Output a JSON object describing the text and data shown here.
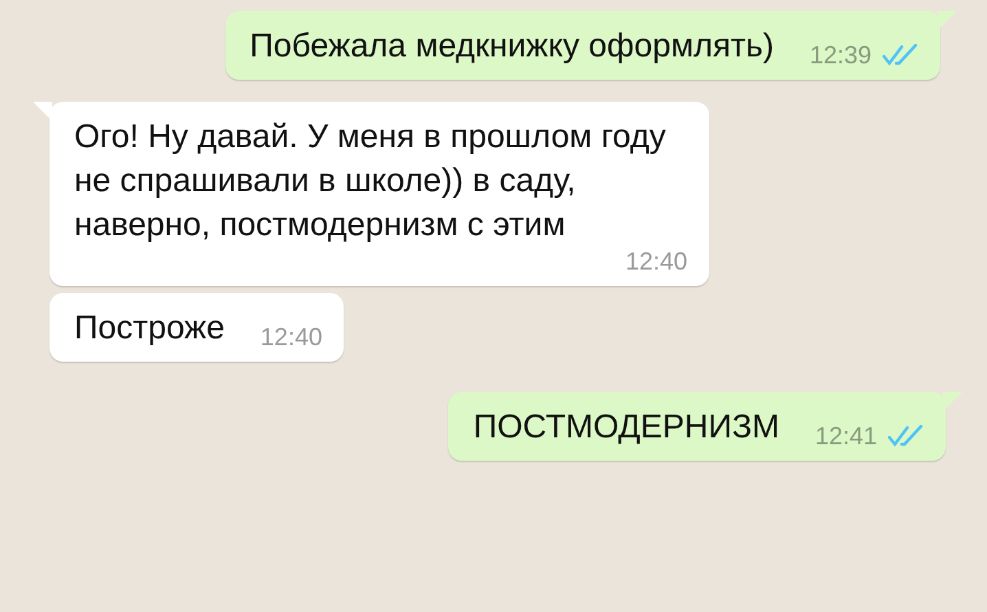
{
  "messages": [
    {
      "kind": "outgoing",
      "text": "Побежала медкнижку оформлять)",
      "time": "12:39",
      "read": true
    },
    {
      "kind": "incoming",
      "text": "Ого! Ну давай. У меня в прошлом году не спрашивали в школе)) в саду, наверно, постмодернизм с этим",
      "time": "12:40"
    },
    {
      "kind": "incoming",
      "text": "Построже",
      "time": "12:40"
    },
    {
      "kind": "outgoing",
      "text": "ПОСТМОДЕРНИЗМ",
      "time": "12:41",
      "read": true
    }
  ]
}
